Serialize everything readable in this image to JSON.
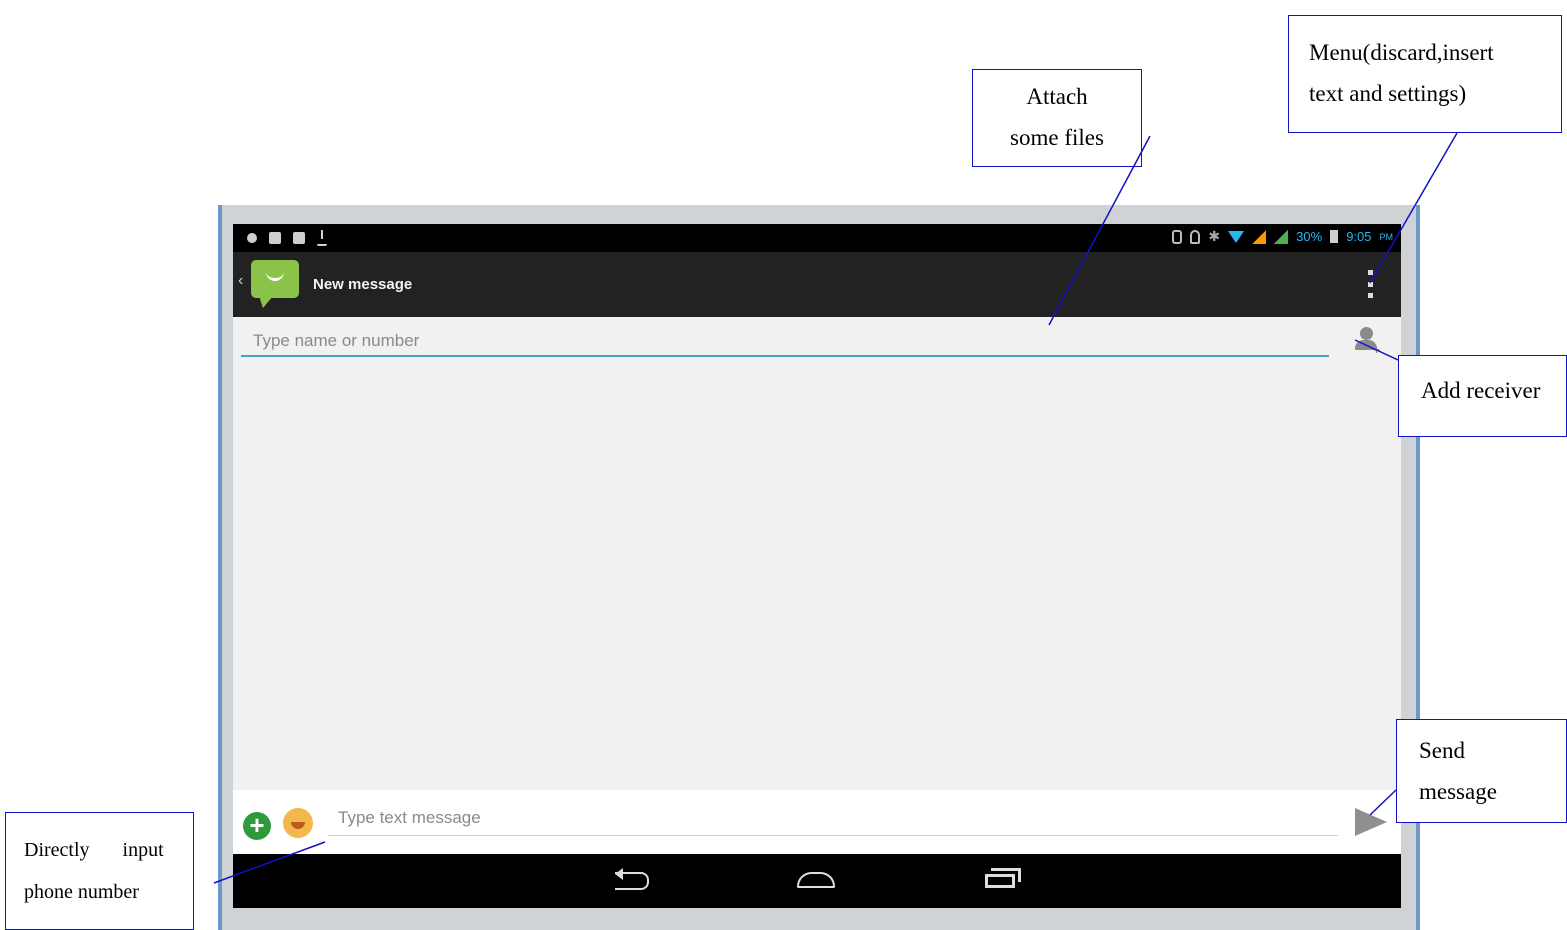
{
  "statusbar": {
    "battery_percent": "30%",
    "time": "9:05",
    "ampm": "PM"
  },
  "actionbar": {
    "title": "New message"
  },
  "recipient": {
    "placeholder": "Type name or number"
  },
  "compose": {
    "placeholder": "Type text message"
  },
  "callouts": {
    "attach_line1": "Attach",
    "attach_line2": "some files",
    "menu_line1": "Menu(discard,insert",
    "menu_line2": "text and settings)",
    "add_receiver": "Add receiver",
    "send_line1": "Send",
    "send_line2": "message",
    "direct_line1": "Directly input",
    "direct_line2": "phone number"
  },
  "colors": {
    "accent_underline": "#3fa7c4",
    "callout_border": "#1212c8",
    "app_icon": "#8bc34a",
    "status_text": "#29b6f6"
  }
}
